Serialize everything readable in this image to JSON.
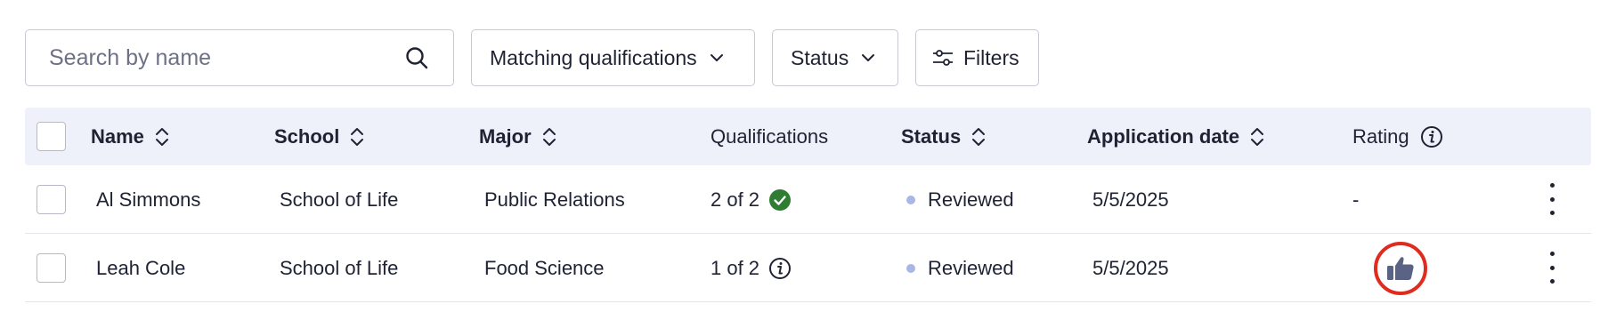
{
  "toolbar": {
    "search_placeholder": "Search by name",
    "matching_label": "Matching qualifications",
    "status_label": "Status",
    "filters_label": "Filters"
  },
  "table": {
    "columns": {
      "name": "Name",
      "school": "School",
      "major": "Major",
      "qualifications": "Qualifications",
      "status": "Status",
      "application_date": "Application date",
      "rating": "Rating"
    },
    "rows": [
      {
        "name": "Al Simmons",
        "school": "School of Life",
        "major": "Public Relations",
        "qualifications": "2 of 2",
        "qualifications_icon": "check-circle-icon",
        "status": "Reviewed",
        "application_date": "5/5/2025",
        "rating": "-"
      },
      {
        "name": "Leah Cole",
        "school": "School of Life",
        "major": "Food Science",
        "qualifications": "1 of 2",
        "qualifications_icon": "info-icon",
        "status": "Reviewed",
        "application_date": "5/5/2025",
        "rating_icon": "thumbs-up-icon"
      }
    ]
  },
  "colors": {
    "header_bg": "#eef1fa",
    "status_dot": "#a9b6e6",
    "check_green": "#2e7d32",
    "highlight_ring": "#e02b1f",
    "thumb_fill": "#5b6385"
  }
}
